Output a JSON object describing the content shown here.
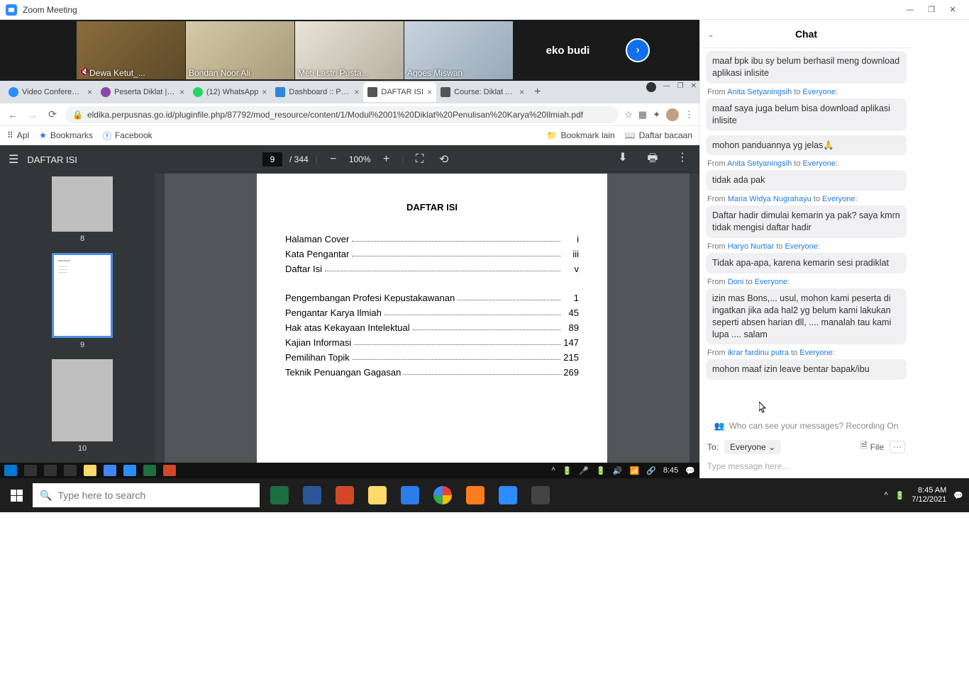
{
  "window": {
    "title": "Zoom Meeting"
  },
  "gallery": {
    "participants": [
      {
        "name": "Dewa Ketut_..."
      },
      {
        "name": "Bondan Noor Ali"
      },
      {
        "name": "Meti Lastri Pusta..."
      },
      {
        "name": "Agoes Miswan"
      }
    ],
    "nameOnly": "eko budi"
  },
  "browser": {
    "tabs": [
      {
        "label": "Video Conferencing",
        "fav": "#2d8cff"
      },
      {
        "label": "Peserta Diklat | PUS",
        "fav": "#8e44ad"
      },
      {
        "label": "(12) WhatsApp",
        "fav": "#25d366"
      },
      {
        "label": "Dashboard :: Pusdik",
        "fav": "#2e86de"
      },
      {
        "label": "DAFTAR ISI",
        "fav": "#555",
        "active": true
      },
      {
        "label": "Course: Diklat Auto",
        "fav": "#555"
      }
    ],
    "url": "eldika.perpusnas.go.id/pluginfile.php/87792/mod_resource/content/1/Modul%2001%20Diklat%20Penulisan%20Karya%20Ilmiah.pdf",
    "bookmarks": {
      "apl": "Apl",
      "bookmarks": "Bookmarks",
      "facebook": "Facebook",
      "bookmarkLain": "Bookmark lain",
      "daftarBacaan": "Daftar bacaan"
    }
  },
  "pdf": {
    "docTitle": "DAFTAR ISI",
    "page": "9",
    "totalPages": "/ 344",
    "zoom": "100%",
    "thumbs": {
      "p8": "8",
      "p9": "9",
      "p10": "10"
    },
    "content": {
      "heading": "DAFTAR ISI",
      "rows": [
        {
          "title": "Halaman Cover",
          "page": "i"
        },
        {
          "title": "Kata Pengantar",
          "page": "iii"
        },
        {
          "title": "Daftar Isi",
          "page": "v"
        },
        {
          "gap": true
        },
        {
          "title": "Pengembangan Profesi Kepustakawanan",
          "page": "1"
        },
        {
          "title": "Pengantar Karya Ilmiah",
          "page": "45"
        },
        {
          "title": "Hak atas Kekayaan Intelektual",
          "page": "89"
        },
        {
          "title": "Kajian Informasi",
          "page": "147"
        },
        {
          "title": "Pemilihan Topik",
          "page": "215"
        },
        {
          "title": "Teknik Penuangan Gagasan",
          "page": "269"
        }
      ]
    }
  },
  "vmTaskbar": {
    "time": "8:45"
  },
  "chat": {
    "title": "Chat",
    "messages": [
      {
        "text": "maaf bpk ibu sy belum berhasil meng download aplikasi  inlisite"
      },
      {
        "from": "Anita Setyaningsih",
        "to": "Everyone"
      },
      {
        "text": "maaf saya juga belum bisa download aplikasi inlisite"
      },
      {
        "text": "mohon panduannya yg jelas🙏"
      },
      {
        "from": "Anita Setyaningsih",
        "to": "Everyone"
      },
      {
        "text": "tidak ada pak"
      },
      {
        "from": "Maria Widya Nugrahayu",
        "to": "Everyone"
      },
      {
        "text": "Daftar hadir dimulai kemarin ya pak? saya kmrn tidak mengisi daftar hadir"
      },
      {
        "from": "Haryo Nurtiar",
        "to": "Everyone"
      },
      {
        "text": "Tidak apa-apa, karena kemarin sesi pradiklat"
      },
      {
        "from": "Doni",
        "to": "Everyone"
      },
      {
        "text": "izin mas Bons,... usul, mohon kami peserta di ingatkan jika ada hal2 yg belum kami lakukan seperti absen harian dll, .... manalah tau kami lupa .... salam"
      },
      {
        "from": "ikrar fardinu putra",
        "to": "Everyone"
      },
      {
        "text": "mohon maaf izin leave bentar bapak/ibu"
      }
    ],
    "info": "Who can see your messages? Recording On",
    "toLabel": "To:",
    "toValue": "Everyone",
    "fileLabel": "File",
    "placeholder": "Type message here..."
  },
  "hostTaskbar": {
    "searchPlaceholder": "Type here to search",
    "apps": [
      {
        "name": "excel",
        "color": "#1d6f42"
      },
      {
        "name": "word",
        "color": "#2b579a"
      },
      {
        "name": "powerpoint",
        "color": "#d24726"
      },
      {
        "name": "file-explorer",
        "color": "#ffd96a"
      },
      {
        "name": "wps",
        "color": "#2b7de9"
      },
      {
        "name": "chrome",
        "color": "linear"
      },
      {
        "name": "xampp",
        "color": "#fb7c1e"
      },
      {
        "name": "zoom",
        "color": "#2d8cff"
      },
      {
        "name": "settings",
        "color": "#444"
      }
    ],
    "time": "8:45 AM",
    "date": "7/12/2021"
  }
}
